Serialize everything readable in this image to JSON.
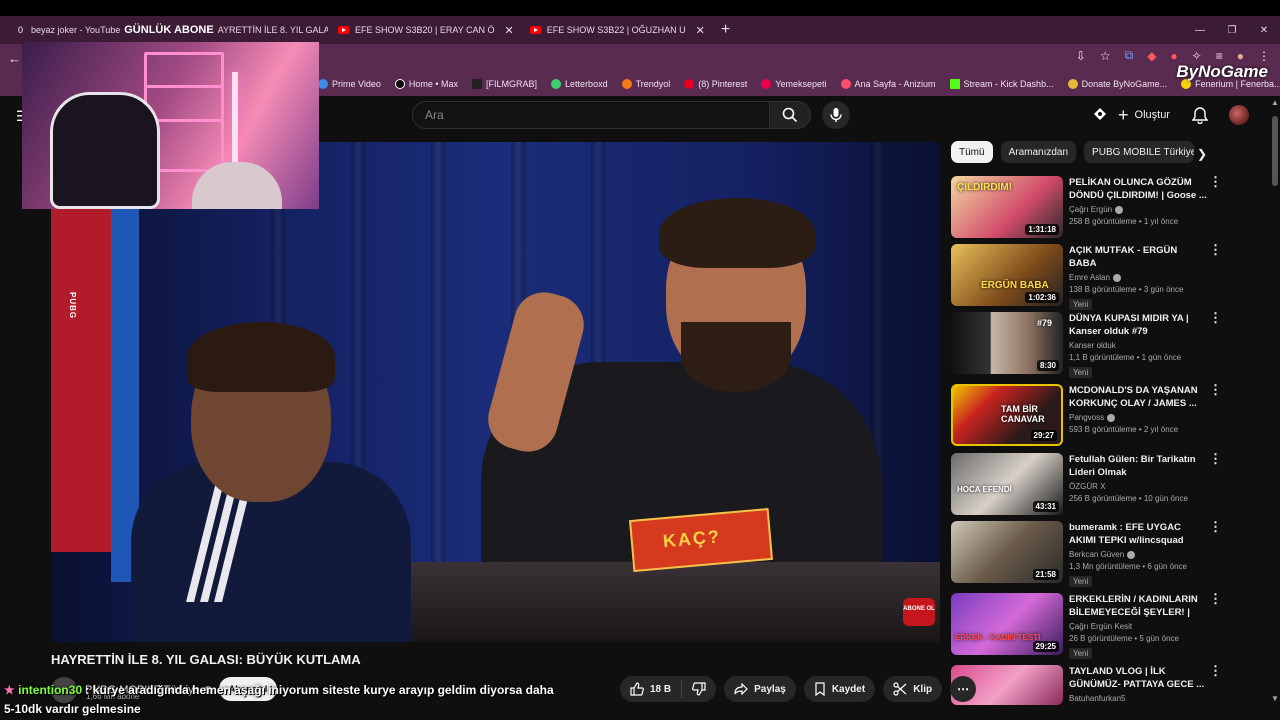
{
  "browser": {
    "tabs": [
      {
        "label": "EFE SHOW S3B20 | ERAY CAN Ö"
      },
      {
        "label": "EFE SHOW S3B22 | OĞUZHAN U"
      }
    ],
    "new_tab": "+",
    "overlay_tab": {
      "count_left": "0",
      "label": "beyaz joker - YouTube",
      "bold": "GÜNLÜK ABONE",
      "rest": "AYRETTİN İLE 8. YIL GALA",
      "count_right": "8"
    },
    "bookmarks": [
      "Prime Video",
      "Home • Max",
      "[FILMGRAB]",
      "Letterboxd",
      "Trendyol",
      "(8) Pinterest",
      "Yemeksepeti",
      "Ana Sayfa - Anizium",
      "Stream - Kick Dashb...",
      "Donate ByNoGame...",
      "Fenerium | Fenerba..."
    ],
    "watermark": "ByNoGame"
  },
  "youtube": {
    "search_placeholder": "Ara",
    "create_label": "Oluştur"
  },
  "video": {
    "title": "HAYRETTİN İLE 8. YIL GALASI: BÜYÜK KUTLAMA",
    "channel": "PUBG MOBILE Türkiye",
    "subscribers": "1,66 Mn abone",
    "subscribe_label": "Abone ol",
    "likes": "18 B",
    "share_label": "Paylaş",
    "save_label": "Kaydet",
    "clip_label": "Klip",
    "card_text": "KAÇ?",
    "abone_badge": "ABONE OL"
  },
  "chips": [
    "Tümü",
    "Aramanızdan",
    "PUBG MOBILE Türkiye ar"
  ],
  "recommendations": [
    {
      "title": "PELİKAN OLUNCA GÖZÜM DÖNDÜ ÇILDIRDIM! | Goose ...",
      "channel": "Çağrı Ergün",
      "meta": "258 B görüntüleme • 1 yıl önce",
      "duration": "1:31:18",
      "thumb_text": "ÇILDIRDIM!",
      "new": ""
    },
    {
      "title": "AÇIK MUTFAK - ERGÜN BABA",
      "channel": "Emre Aslan",
      "meta": "138 B görüntüleme • 3 gün önce",
      "duration": "1:02:36",
      "thumb_text": "ERGÜN BABA",
      "new": "Yeni"
    },
    {
      "title": "DÜNYA KUPASI MIDIR YA | Kanser olduk #79",
      "channel": "Kanser olduk",
      "meta": "1,1 B görüntüleme • 1 gün önce",
      "duration": "8:30",
      "thumb_text": "#79",
      "new": "Yeni"
    },
    {
      "title": "MCDONALD'S DA YAŞANAN KORKUNÇ OLAY / JAMES ...",
      "channel": "Pangvoss",
      "meta": "593 B görüntüleme • 2 yıl önce",
      "duration": "29:27",
      "thumb_text": "TAM BİR CANAVAR",
      "new": ""
    },
    {
      "title": "Fetullah Gülen: Bir Tarikatın Lideri Olmak",
      "channel": "ÖZGÜR X",
      "meta": "256 B görüntüleme • 10 gün önce",
      "duration": "43:31",
      "thumb_text": "HOCA EFENDİ",
      "new": ""
    },
    {
      "title": "bumeramk : EFE UYGAC AKIMI TEPKI w/lincsquad",
      "channel": "Berkcan Güven",
      "meta": "1,3 Mn görüntüleme • 6 gün önce",
      "duration": "21:58",
      "thumb_text": "",
      "new": "Yeni"
    },
    {
      "title": "ERKEKLERİN / KADINLARIN BİLEMEYECEĞİ ŞEYLER! | Quizei",
      "channel": "Çağrı Ergün Kesit",
      "meta": "26 B görüntüleme • 5 gün önce",
      "duration": "29:25",
      "thumb_text": "ERKEK - KADIN TESTİ",
      "new": "Yeni"
    },
    {
      "title": "TAYLAND VLOG | İLK GÜNÜMÜZ- PATTAYA GECE ...",
      "channel": "Batuhanfurkan5",
      "meta": "",
      "duration": "",
      "thumb_text": "",
      "new": ""
    }
  ],
  "chat": {
    "user": "intention30",
    "line1": ": kurye aradığında hemen aşağı iniyorum siteste kurye arayıp geldim diyorsa daha",
    "line2": "5-10dk vardır gelmesine"
  },
  "colors": {
    "accent": "#ff0000",
    "browser_frame": "#5a2b51",
    "chat_user": "#7cff3a"
  }
}
